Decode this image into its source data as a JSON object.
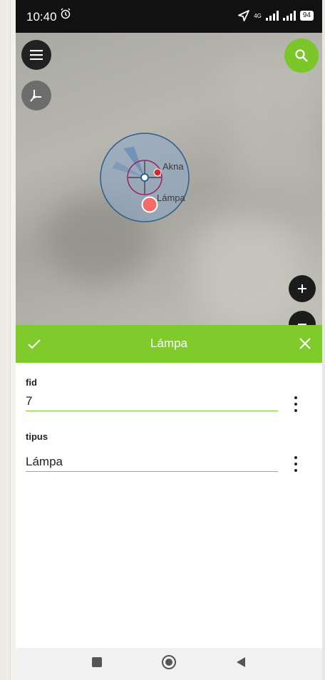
{
  "status_bar": {
    "time": "10:40",
    "network_label": "4G",
    "battery": "94",
    "icons": [
      "alarm-icon",
      "location-arrow-icon",
      "signal-icon",
      "battery-icon"
    ]
  },
  "map": {
    "labels": [
      "Akna",
      "Lámpa"
    ],
    "buttons": [
      "menu-icon",
      "digitize-icon",
      "search-icon",
      "zoom-in-icon",
      "zoom-out-icon"
    ],
    "accent_color": "#7fcb2c",
    "feature_color": "#f56a6a"
  },
  "form": {
    "title": "Lámpa",
    "fields": [
      {
        "label": "fid",
        "value": "7"
      },
      {
        "label": "tipus",
        "value": "Lámpa"
      }
    ]
  },
  "navbar": {
    "buttons": [
      "recents-icon",
      "home-icon",
      "back-icon"
    ]
  }
}
